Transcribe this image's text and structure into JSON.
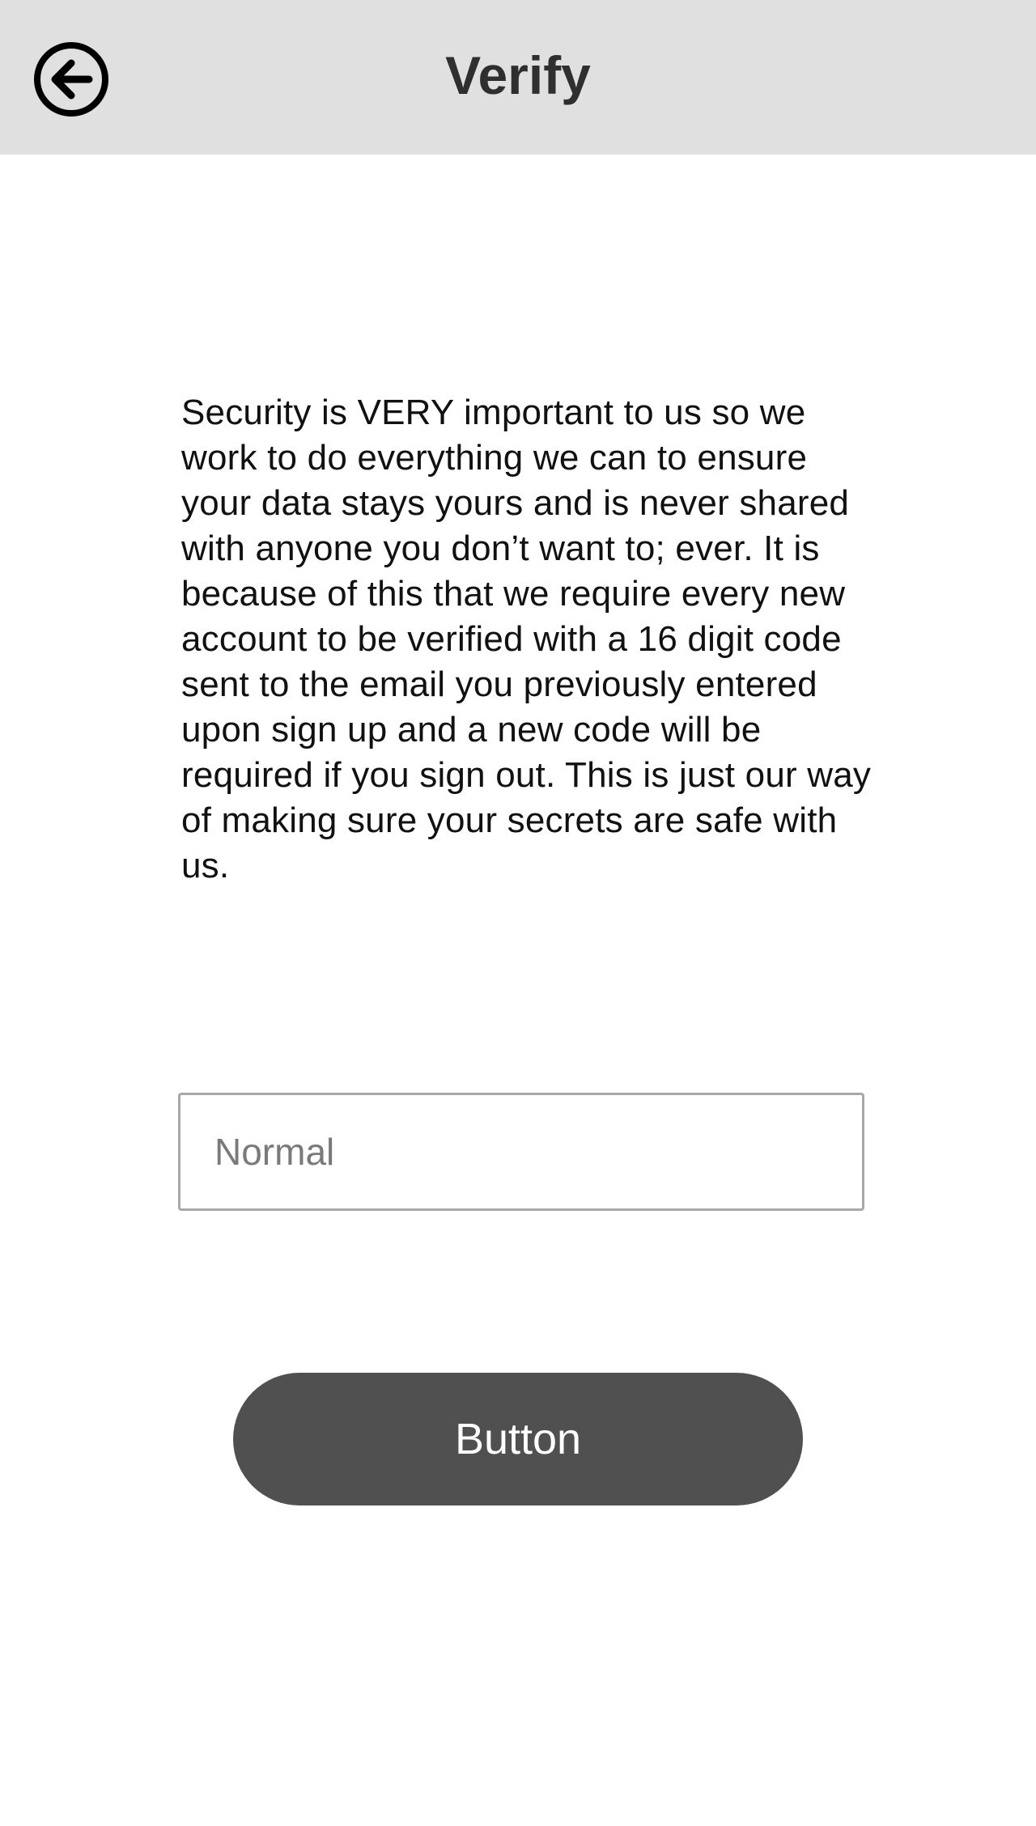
{
  "header": {
    "title": "Verify",
    "back_icon": "arrow-left-circle-icon"
  },
  "main": {
    "description": "Security is VERY important to us so we work to do everything we can to ensure your data stays yours and is never shared with anyone you don’t want to; ever. It is because of this that we require every new account to be verified with a 16 digit code sent to the email you previously entered upon sign up and a new code will be required if you sign out. This is just our way of making sure your secrets are safe with us.",
    "code_input": {
      "value": "",
      "placeholder": "Normal"
    },
    "submit_button_label": "Button"
  },
  "colors": {
    "header_bg": "#e0e0e0",
    "button_bg": "#505050",
    "input_border": "#a8a8a8"
  }
}
